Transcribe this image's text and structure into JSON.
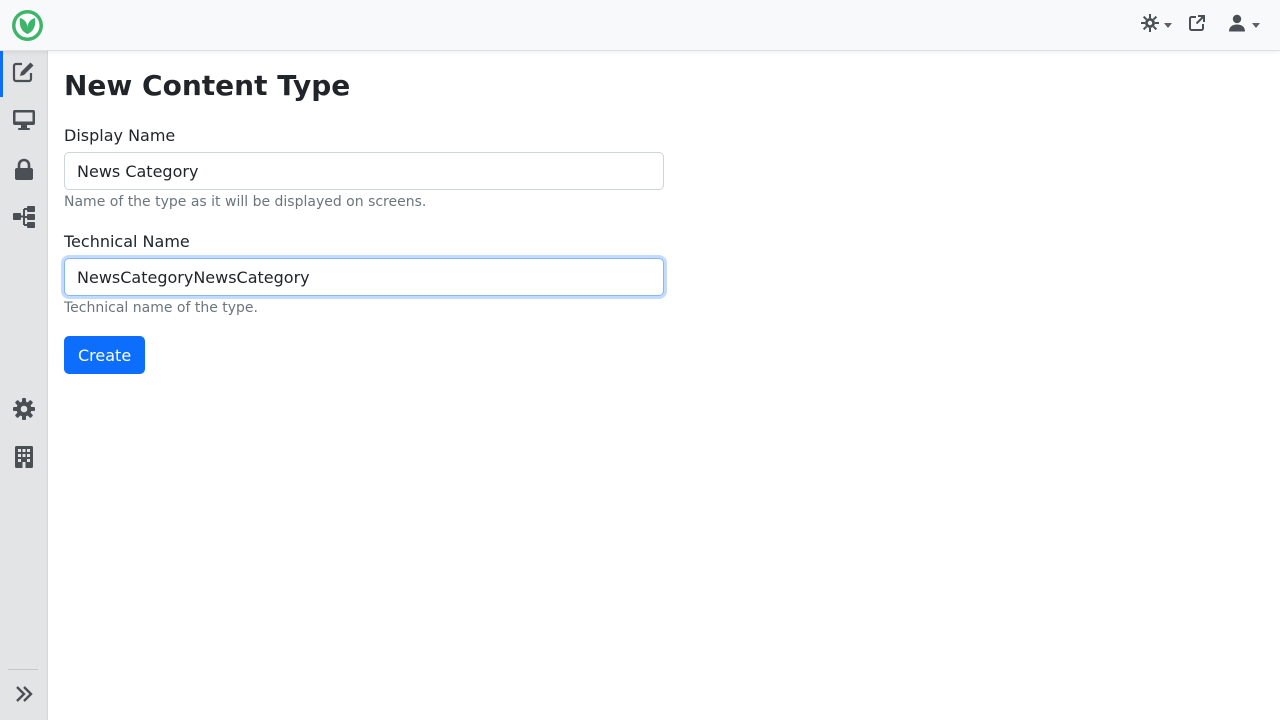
{
  "header": {
    "logo_icon": "leaf-logo-icon",
    "actions": [
      {
        "name": "theme-toggle",
        "icon": "sun-gear-icon"
      },
      {
        "name": "open-site",
        "icon": "external-link-icon"
      },
      {
        "name": "user-menu",
        "icon": "user-icon"
      }
    ]
  },
  "sidebar": {
    "items": [
      {
        "name": "content",
        "icon": "edit-icon",
        "active": true
      },
      {
        "name": "design",
        "icon": "desktop-icon"
      },
      {
        "name": "security",
        "icon": "lock-icon"
      },
      {
        "name": "structure",
        "icon": "sitemap-icon"
      },
      {
        "name": "configuration",
        "icon": "gear-icon"
      },
      {
        "name": "tenants",
        "icon": "building-icon"
      }
    ],
    "collapse_icon": "chevrons-right-icon"
  },
  "page": {
    "title": "New Content Type",
    "display_name": {
      "label": "Display Name",
      "value": "News Category",
      "help": "Name of the type as it will be displayed on screens."
    },
    "technical_name": {
      "label": "Technical Name",
      "value": "NewsCategoryNewsCategory",
      "help": "Technical name of the type."
    },
    "create_label": "Create"
  },
  "colors": {
    "primary": "#0d6efd",
    "logo_green": "#3fb56b",
    "icon_gray": "#4a4f55"
  }
}
